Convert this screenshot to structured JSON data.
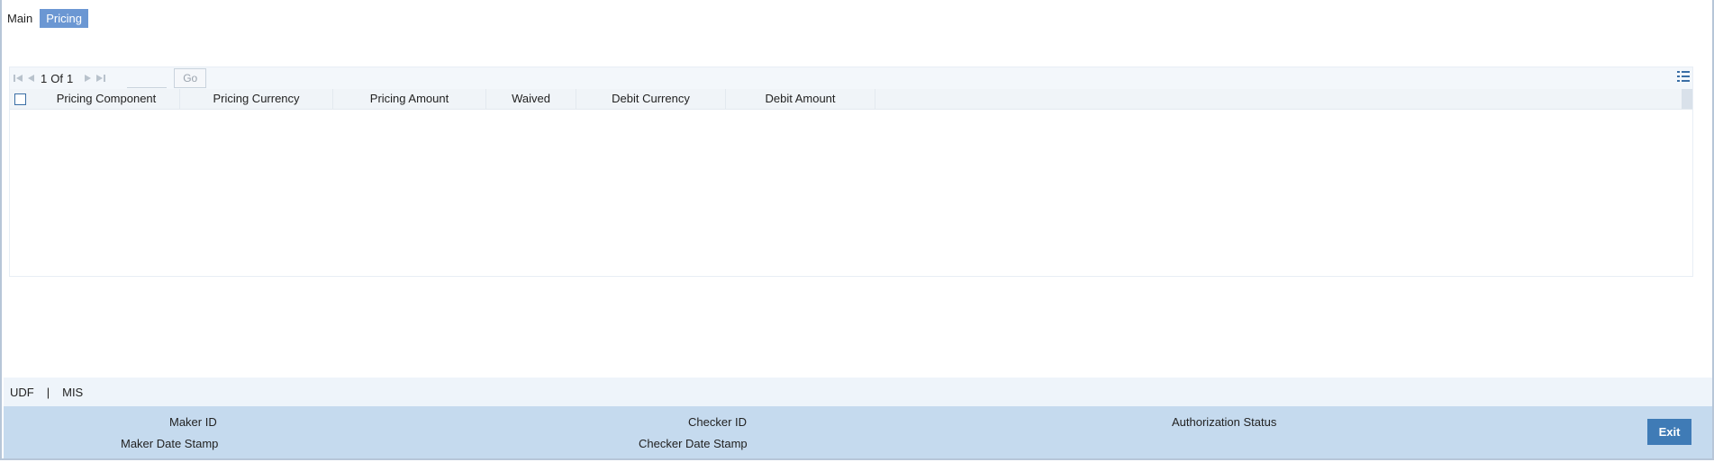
{
  "tabs": [
    {
      "label": "Main"
    },
    {
      "label": "Pricing"
    }
  ],
  "pager": {
    "current": "1",
    "of_label": "Of",
    "total": "1",
    "go_label": "Go"
  },
  "grid": {
    "columns": [
      "Pricing Component",
      "Pricing Currency",
      "Pricing Amount",
      "Waived",
      "Debit Currency",
      "Debit Amount"
    ],
    "rows": []
  },
  "footer": {
    "links": [
      "UDF",
      "MIS"
    ],
    "separator": "|"
  },
  "audit": {
    "maker_id_label": "Maker ID",
    "maker_date_label": "Maker Date Stamp",
    "checker_id_label": "Checker ID",
    "checker_date_label": "Checker Date Stamp",
    "auth_status_label": "Authorization Status",
    "exit_label": "Exit"
  },
  "colors": {
    "active_tab": "#6b97d3",
    "audit_bar": "#c5daee",
    "exit_button": "#3f7bb6"
  }
}
